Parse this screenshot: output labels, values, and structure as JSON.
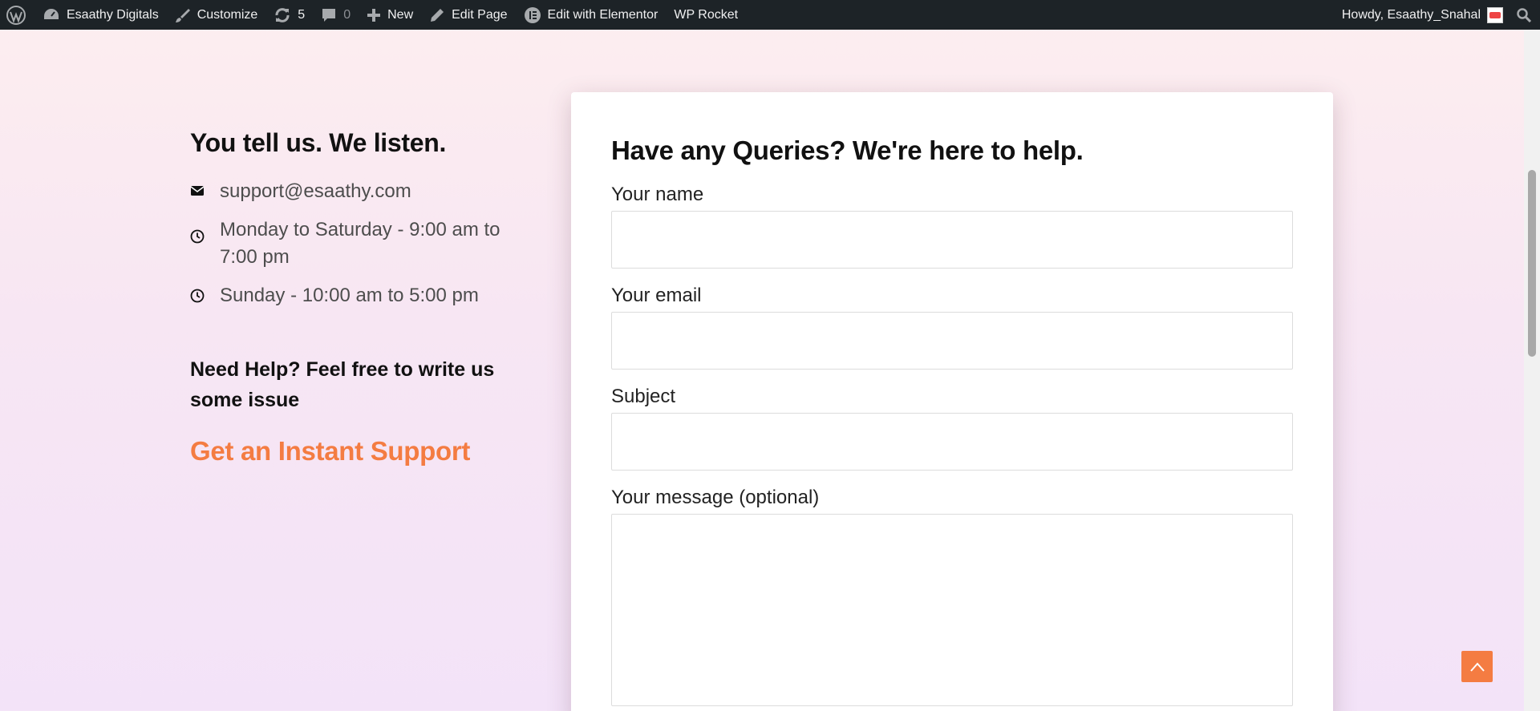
{
  "adminbar": {
    "site_name": "Esaathy Digitals",
    "customize": "Customize",
    "updates_count": "5",
    "comments_count": "0",
    "new_label": "New",
    "edit_page": "Edit Page",
    "edit_elementor": "Edit with Elementor",
    "wp_rocket": "WP Rocket",
    "howdy": "Howdy, Esaathy_Snahal"
  },
  "left": {
    "heading": "You tell us. We listen.",
    "email": "support@esaathy.com",
    "hours_weekday": "Monday to Saturday - 9:00 am to 7:00 pm",
    "hours_sunday": "Sunday - 10:00 am to 5:00 pm",
    "help_text": "Need Help? Feel free to write us some issue",
    "instant_support": "Get an Instant Support"
  },
  "form": {
    "heading": "Have any Queries? We're here to help.",
    "name_label": "Your name",
    "name_value": "",
    "email_label": "Your email",
    "email_value": "",
    "subject_label": "Subject",
    "subject_value": "",
    "message_label": "Your message (optional)",
    "message_value": ""
  },
  "colors": {
    "accent": "#f47c42",
    "adminbar": "#1d2327"
  },
  "icons": [
    "wordpress-icon",
    "dashboard-icon",
    "brush-icon",
    "updates-icon",
    "comments-icon",
    "plus-icon",
    "pencil-icon",
    "elementor-icon",
    "search-icon",
    "envelope-icon",
    "clock-icon",
    "chevron-up-icon"
  ]
}
